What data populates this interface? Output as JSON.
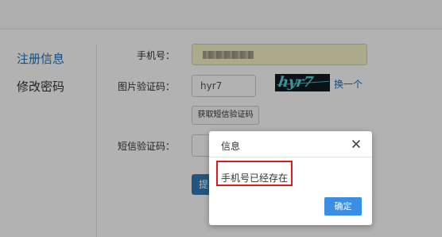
{
  "sidebar": {
    "items": [
      {
        "label": "注册信息",
        "active": true
      },
      {
        "label": "修改密码",
        "active": false
      }
    ]
  },
  "form": {
    "phone_label": "手机号：",
    "image_code_label": "图片验证码：",
    "image_code_value": "hyr7",
    "captcha_text": "hyr7",
    "refresh_link": "换一个",
    "get_sms_button": "获取短信验证码",
    "sms_code_label": "短信验证码：",
    "submit_label": "提"
  },
  "dialog": {
    "title": "信息",
    "message": "手机号已经存在",
    "ok_label": "确定"
  },
  "colors": {
    "accent": "#337ab7",
    "link": "#1f6fb2",
    "dialog_button": "#3a8ee6",
    "highlight_border": "#e0191c",
    "phone_autofill_bg": "#f7f4c6"
  }
}
